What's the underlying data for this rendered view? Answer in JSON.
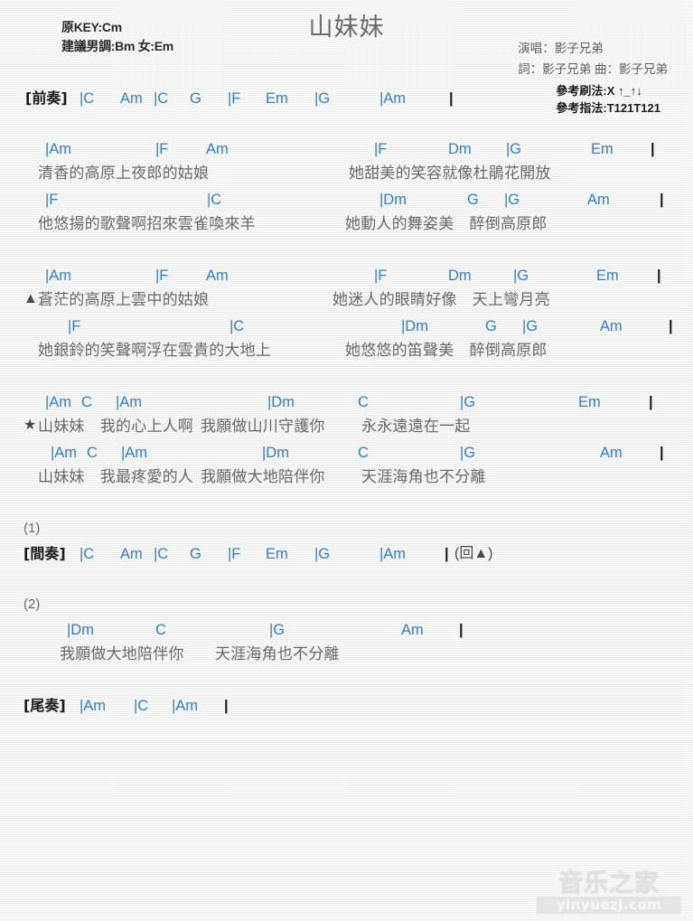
{
  "header": {
    "original_key": "原KEY:Cm",
    "suggested_key": "建議男調:Bm 女:Em",
    "title": "山妹妹",
    "singer": "演唱：影子兄弟",
    "writers": "詞：影子兄弟  曲：影子兄弟",
    "strum_ref": "參考刷法:X ↑_↑↓",
    "fingerstyle_ref": "參考指法:T121T121"
  },
  "colors": {
    "chord": "#2f7fd6",
    "lyric": "#6a6a6a",
    "bar": "#1a1a1a",
    "page_bg": "#f2f2f2"
  },
  "sections": {
    "intro": {
      "label": "[前奏]",
      "chords": [
        "|C",
        "Am",
        "|C",
        "G",
        "|F",
        "Em",
        "|G",
        "|Am",
        "|"
      ]
    },
    "interlude": {
      "label": "[間奏]",
      "ending_num": "(1)",
      "chords": [
        "|C",
        "Am",
        "|C",
        "G",
        "|F",
        "Em",
        "|G",
        "|Am",
        "|"
      ],
      "repeat_note": "(回▲)"
    },
    "ending2": {
      "ending_num": "(2)",
      "chords": [
        "|Dm",
        "C",
        "|G",
        "Am",
        "|"
      ],
      "lyric": "我願做大地陪伴你　　天涯海角也不分離"
    },
    "outro": {
      "label": "[尾奏]",
      "chords": [
        "|Am",
        "|C",
        "|Am",
        "|"
      ]
    }
  },
  "verse1": {
    "line1": {
      "chords": [
        "|Am",
        "|F",
        "Am",
        "|F",
        "Dm",
        "|G",
        "Em",
        "|"
      ],
      "lyric_left": "清香的高原上夜郎的姑娘",
      "lyric_right": "她甜美的笑容就像杜鵑花開放"
    },
    "line2": {
      "chords": [
        "|F",
        "|C",
        "|Dm",
        "G",
        "|G",
        "Am",
        "|"
      ],
      "lyric_left": "他悠揚的歌聲啊招來雲雀喚來羊",
      "lyric_right": "她動人的舞姿美　醉倒高原郎"
    }
  },
  "verse2": {
    "marker": "▲",
    "line1": {
      "chords": [
        "|Am",
        "|F",
        "Am",
        "|F",
        "Dm",
        "|G",
        "Em",
        "|"
      ],
      "lyric_left": "蒼茫的高原上雲中的姑娘",
      "lyric_right": "她迷人的眼睛好像　天上彎月亮"
    },
    "line2": {
      "chords": [
        "|F",
        "|C",
        "|Dm",
        "G",
        "|G",
        "Am",
        "|"
      ],
      "lyric_left": "她銀鈴的笑聲啊浮在雲貴的大地上",
      "lyric_right": "她悠悠的笛聲美　醉倒高原郎"
    }
  },
  "chorus": {
    "marker": "★",
    "line1": {
      "chords": [
        "|Am",
        "C",
        "|Am",
        "|Dm",
        "C",
        "|G",
        "Em",
        "|"
      ],
      "lyric_a": "山妹妹　我的心上人啊",
      "lyric_b": "我願做山川守護你",
      "lyric_c": "永永遠遠在一起"
    },
    "line2": {
      "chords": [
        "|Am",
        "C",
        "|Am",
        "|Dm",
        "C",
        "|G",
        "Am",
        "|"
      ],
      "lyric_a": "山妹妹　我最疼愛的人",
      "lyric_b": "我願做大地陪伴你",
      "lyric_c": "天涯海角也不分離"
    }
  },
  "watermark": {
    "cn": "音乐之家",
    "url": "yinyuezj.com"
  }
}
